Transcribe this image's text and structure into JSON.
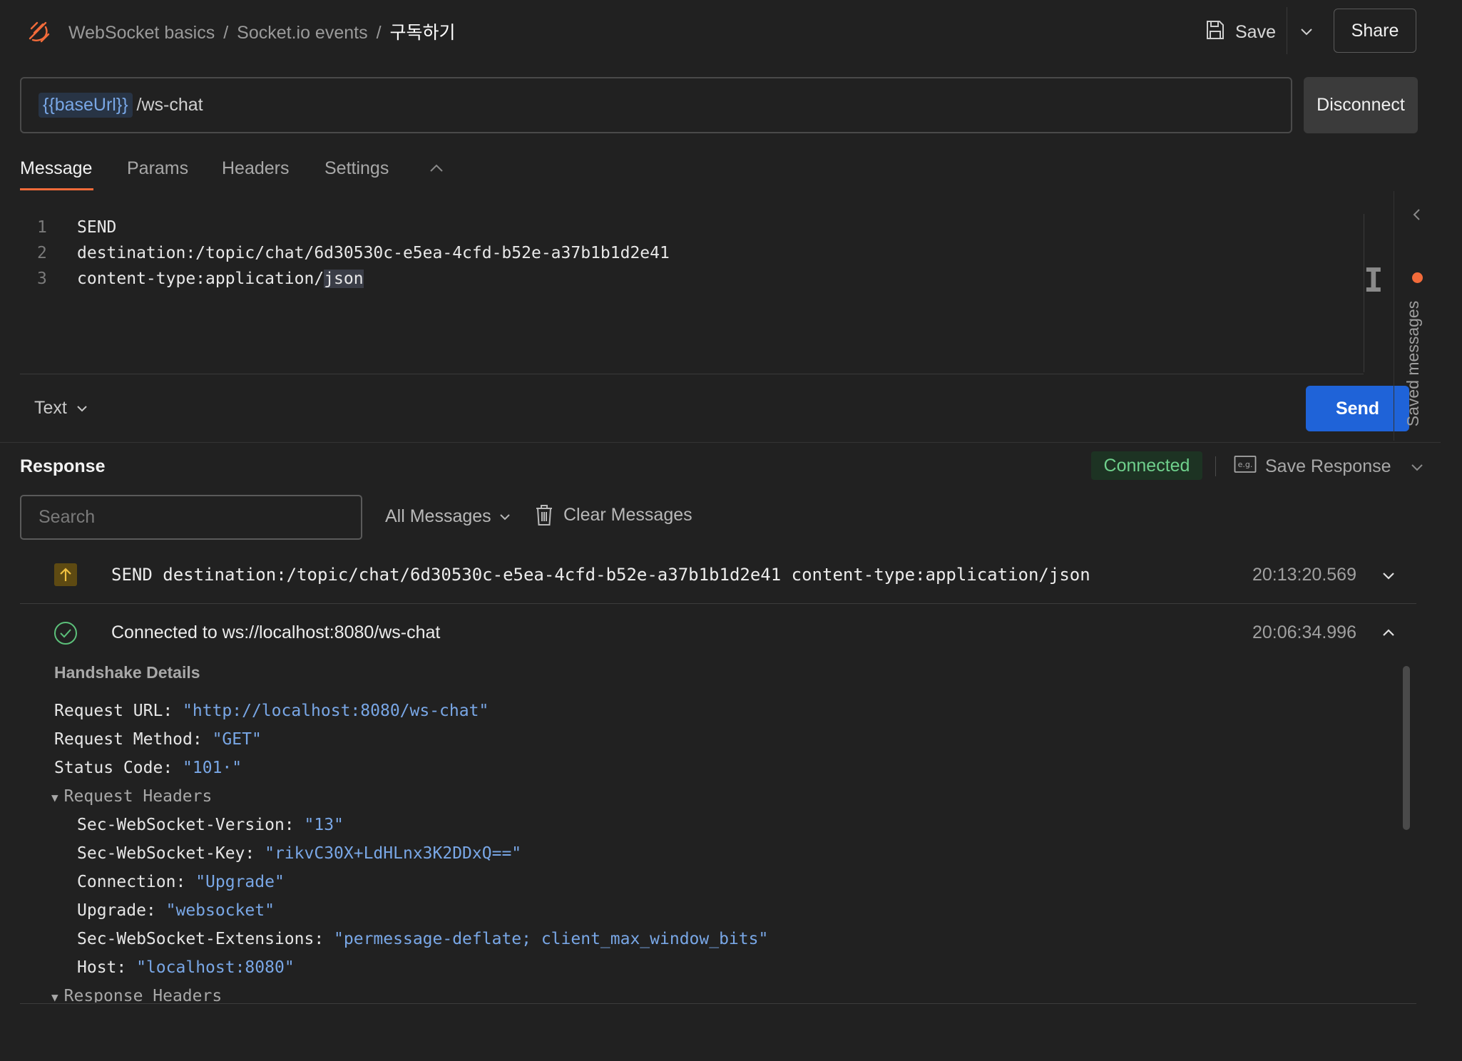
{
  "header": {
    "breadcrumbs": [
      "WebSocket basics",
      "Socket.io events",
      "구독하기"
    ],
    "separator": "/",
    "save_label": "Save",
    "share_label": "Share"
  },
  "request": {
    "url_variable": "{{baseUrl}}",
    "url_path": "/ws-chat",
    "disconnect_label": "Disconnect"
  },
  "tabs": [
    {
      "label": "Message",
      "active": true
    },
    {
      "label": "Params",
      "active": false
    },
    {
      "label": "Headers",
      "active": false
    },
    {
      "label": "Settings",
      "active": false
    }
  ],
  "editor": {
    "lines": [
      {
        "num": "1",
        "text": "SEND"
      },
      {
        "num": "2",
        "text": "destination:/topic/chat/6d30530c-e5ea-4cfd-b52e-a37b1b1d2e41"
      },
      {
        "num": "3",
        "text_prefix": "content-type:application/",
        "text_highlight": "json"
      }
    ],
    "format_label": "Text",
    "send_label": "Send"
  },
  "rail": {
    "label": "Saved messages",
    "accent": "#f26b3a"
  },
  "response": {
    "title": "Response",
    "status": "Connected",
    "save_response_label": "Save Response",
    "search_placeholder": "Search",
    "filter_label": "All Messages",
    "clear_label": "Clear Messages",
    "messages": [
      {
        "direction": "sent",
        "text": "SEND destination:/topic/chat/6d30530c-e5ea-4cfd-b52e-a37b1b1d2e41 content-type:application/json",
        "time": "20:13:20.569"
      },
      {
        "direction": "connected",
        "text": "Connected to ws://localhost:8080/ws-chat",
        "time": "20:06:34.996"
      }
    ],
    "handshake": {
      "title": "Handshake Details",
      "request_url_key": "Request URL:",
      "request_url_value": "\"http://localhost:8080/ws-chat\"",
      "request_method_key": "Request Method:",
      "request_method_value": "\"GET\"",
      "status_code_key": "Status Code:",
      "status_code_value": "\"101·\"",
      "request_headers_label": "Request Headers",
      "headers": [
        {
          "key": "Sec-WebSocket-Version:",
          "value": "\"13\""
        },
        {
          "key": "Sec-WebSocket-Key:",
          "value": "\"rikvC30X+LdHLnx3K2DDxQ==\""
        },
        {
          "key": "Connection:",
          "value": "\"Upgrade\""
        },
        {
          "key": "Upgrade:",
          "value": "\"websocket\""
        },
        {
          "key": "Sec-WebSocket-Extensions:",
          "value": "\"permessage-deflate; client_max_window_bits\""
        },
        {
          "key": "Host:",
          "value": "\"localhost:8080\""
        }
      ],
      "response_headers_label": "Response Headers"
    }
  },
  "colors": {
    "accent_orange": "#f26b3a",
    "primary_blue": "#1f63d8",
    "connected_green": "#6fd08c",
    "value_blue": "#79a7e6"
  }
}
